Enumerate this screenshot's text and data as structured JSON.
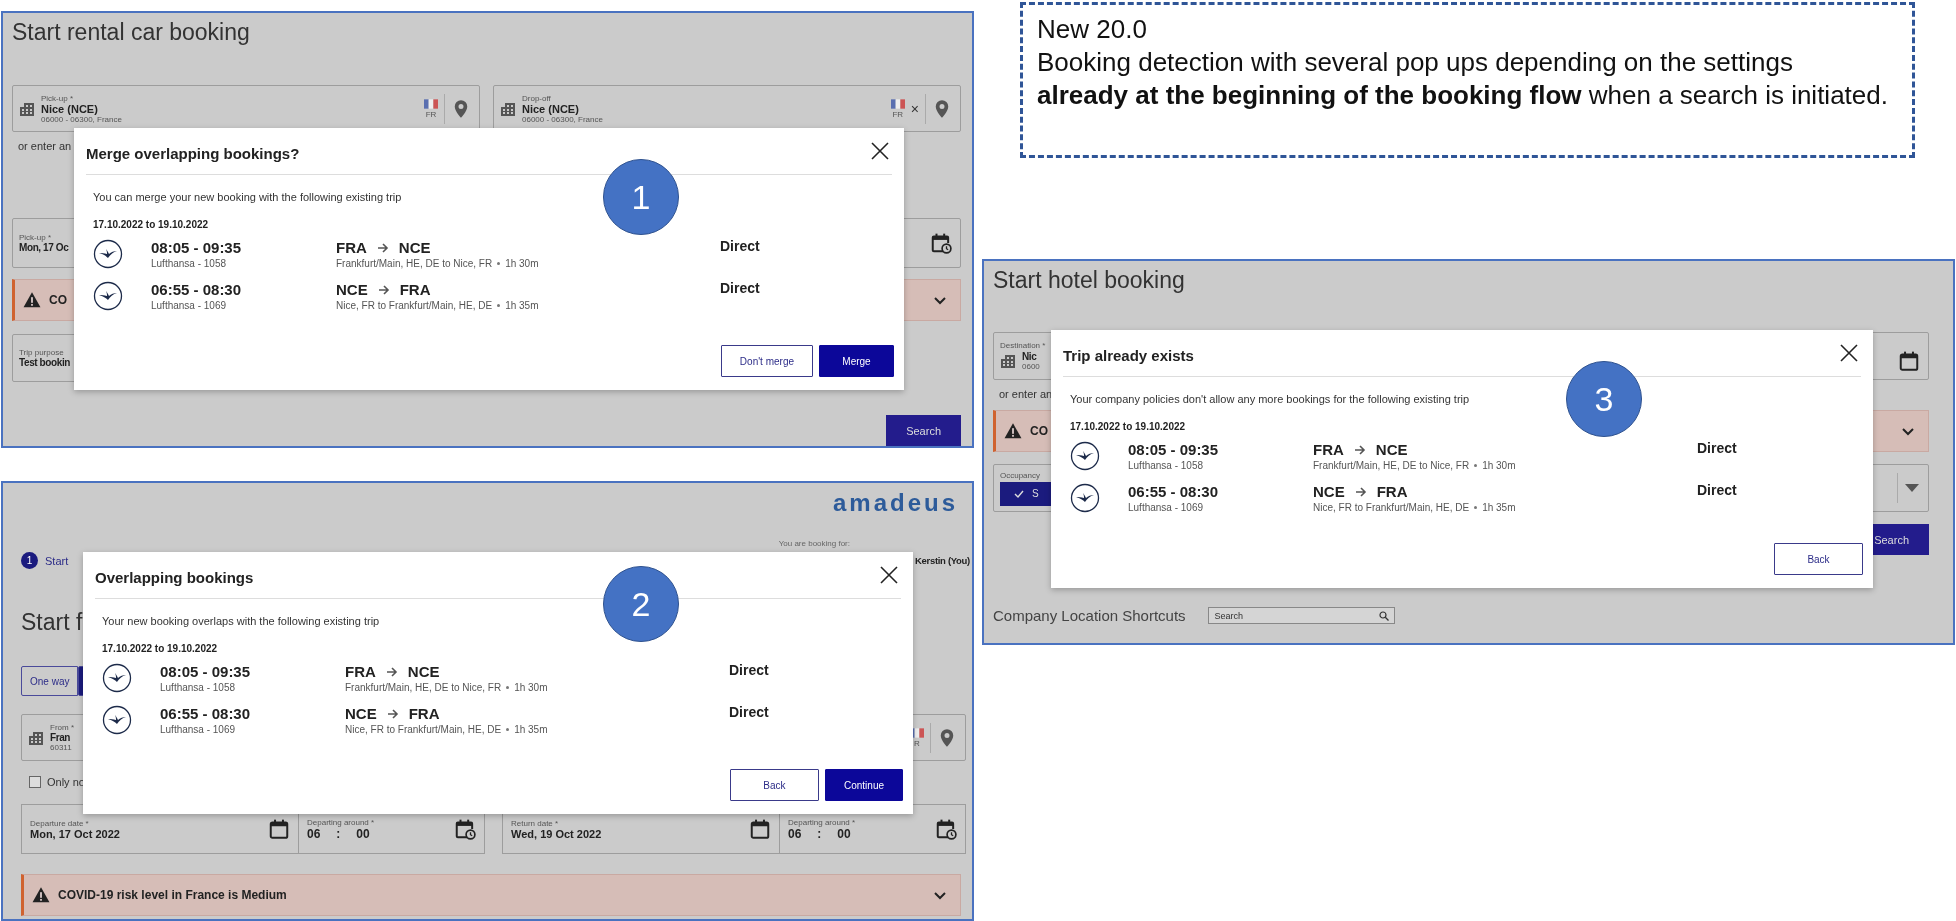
{
  "note": {
    "title": "New 20.0",
    "text": "Booking detection with several pop ups depending on the settings **already at the beginning of the booking flow** when a search is initiated."
  },
  "panels": [
    {
      "kind": "car",
      "title": "Start rental car booking",
      "pickup": {
        "label": "Pick-up *",
        "value": "Nice (NCE)",
        "sub": "06000 - 06300, France",
        "flag": "FR"
      },
      "dropoff": {
        "label": "Drop-off",
        "value": "Nice (NCE)",
        "sub": "06000 - 06300, France",
        "flag": "FR",
        "clear": "×"
      },
      "hint": "or enter an",
      "date": {
        "label": "Pick-up *",
        "value": "Mon, 17 Oc"
      },
      "alert": "CO",
      "purpose": {
        "label": "Trip purpose",
        "value": "Test bookin"
      },
      "search": "Search",
      "dialog": {
        "badge": "1",
        "title": "Merge overlapping bookings?",
        "message": "You can merge your new booking with the following existing trip",
        "date_range": "17.10.2022 to 19.10.2022",
        "flights": [
          {
            "times": "08:05 - 09:35",
            "carrier": "Lufthansa - 1058",
            "from": "FRA",
            "to": "NCE",
            "route": "Frankfurt/Main, HE, DE to Nice, FR",
            "duration": "1h 30m",
            "stops": "Direct"
          },
          {
            "times": "06:55 - 08:30",
            "carrier": "Lufthansa - 1069",
            "from": "NCE",
            "to": "FRA",
            "route": "Nice, FR to Frankfurt/Main, HE, DE",
            "duration": "1h 35m",
            "stops": "Direct"
          }
        ],
        "buttons": [
          {
            "label": "Don't merge",
            "kind": "secondary"
          },
          {
            "label": "Merge",
            "kind": "primary"
          }
        ]
      }
    },
    {
      "kind": "flight",
      "logo": "amadeus",
      "booking_for": "You are booking for:",
      "traveler": "Kerstin (You)",
      "step": {
        "number": "1",
        "label": "Start"
      },
      "title": "Start f",
      "tabs": [
        {
          "label": "One way",
          "selected": false
        },
        {
          "selected": true
        }
      ],
      "from": {
        "label": "From *",
        "value": "Fran",
        "sub": "60311",
        "flag": "R"
      },
      "checkbox": {
        "label": "Only no",
        "checked": false
      },
      "dates": [
        {
          "kind": "date",
          "label": "Departure date *",
          "value": "Mon, 17 Oct 2022"
        },
        {
          "kind": "time",
          "label": "Departing around *",
          "hour": "06",
          "separator": ":",
          "minute": "00"
        },
        {
          "kind": "date",
          "label": "Return date *",
          "value": "Wed, 19 Oct 2022"
        },
        {
          "kind": "time",
          "label": "Departing around *",
          "hour": "06",
          "separator": ":",
          "minute": "00"
        }
      ],
      "alert": "COVID-19 risk level in France is Medium",
      "dialog": {
        "badge": "2",
        "title": "Overlapping bookings",
        "message": "Your new booking overlaps with the following existing trip",
        "date_range": "17.10.2022 to 19.10.2022",
        "flights": [
          {
            "times": "08:05 - 09:35",
            "carrier": "Lufthansa - 1058",
            "from": "FRA",
            "to": "NCE",
            "route": "Frankfurt/Main, HE, DE to Nice, FR",
            "duration": "1h 30m",
            "stops": "Direct"
          },
          {
            "times": "06:55 - 08:30",
            "carrier": "Lufthansa - 1069",
            "from": "NCE",
            "to": "FRA",
            "route": "Nice, FR to Frankfurt/Main, HE, DE",
            "duration": "1h 35m",
            "stops": "Direct"
          }
        ],
        "buttons": [
          {
            "label": "Back",
            "kind": "secondary"
          },
          {
            "label": "Continue",
            "kind": "primary"
          }
        ]
      }
    },
    {
      "kind": "hotel",
      "title": "Start hotel booking",
      "destination": {
        "label": "Destination *",
        "value": "Nic",
        "sub": "0600"
      },
      "hint": "or enter an",
      "alert": "CO",
      "occupancy": {
        "label": "Occupancy",
        "button": "S"
      },
      "search": "Search",
      "shortcuts": {
        "label": "Company Location Shortcuts",
        "placeholder": "Search"
      },
      "dialog": {
        "badge": "3",
        "title": "Trip already exists",
        "message": "Your company policies don't allow any more bookings for the following existing trip",
        "date_range": "17.10.2022 to 19.10.2022",
        "flights": [
          {
            "times": "08:05 - 09:35",
            "carrier": "Lufthansa - 1058",
            "from": "FRA",
            "to": "NCE",
            "route": "Frankfurt/Main, HE, DE to Nice, FR",
            "duration": "1h 30m",
            "stops": "Direct"
          },
          {
            "times": "06:55 - 08:30",
            "carrier": "Lufthansa - 1069",
            "from": "NCE",
            "to": "FRA",
            "route": "Nice, FR to Frankfurt/Main, HE, DE",
            "duration": "1h 35m",
            "stops": "Direct"
          }
        ],
        "buttons": [
          {
            "label": "Back",
            "kind": "secondary"
          }
        ]
      }
    }
  ]
}
